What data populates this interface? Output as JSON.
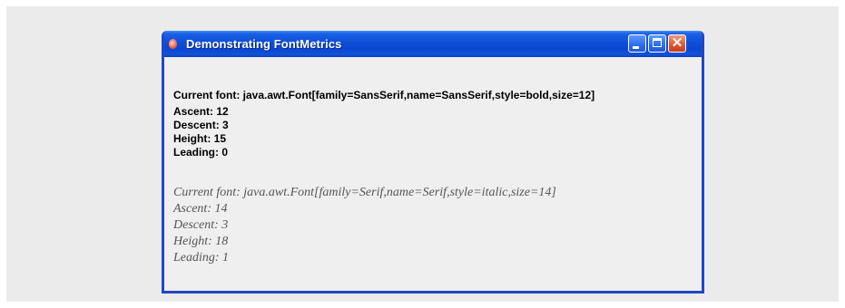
{
  "window": {
    "title": "Demonstrating FontMetrics"
  },
  "title_bar_buttons": {
    "minimize_icon": "minimize-icon",
    "maximize_icon": "maximize-icon",
    "close_icon": "close-icon"
  },
  "metrics": {
    "sans_bold": {
      "current_font": "Current font: java.awt.Font[family=SansSerif,name=SansSerif,style=bold,size=12]",
      "ascent": "Ascent: 12",
      "descent": "Descent: 3",
      "height": "Height: 15",
      "leading": "Leading: 0"
    },
    "serif_italic": {
      "current_font": "Current font: java.awt.Font[family=Serif,name=Serif,style=italic,size=14]",
      "ascent": "Ascent: 14",
      "descent": "Descent: 3",
      "height": "Height: 18",
      "leading": "Leading: 1"
    }
  },
  "colors": {
    "title_bar": "#0b47d1",
    "window_border": "#1f48c6",
    "close_button": "#e05a36",
    "client_area": "#efefef",
    "italic_text": "#555555"
  }
}
